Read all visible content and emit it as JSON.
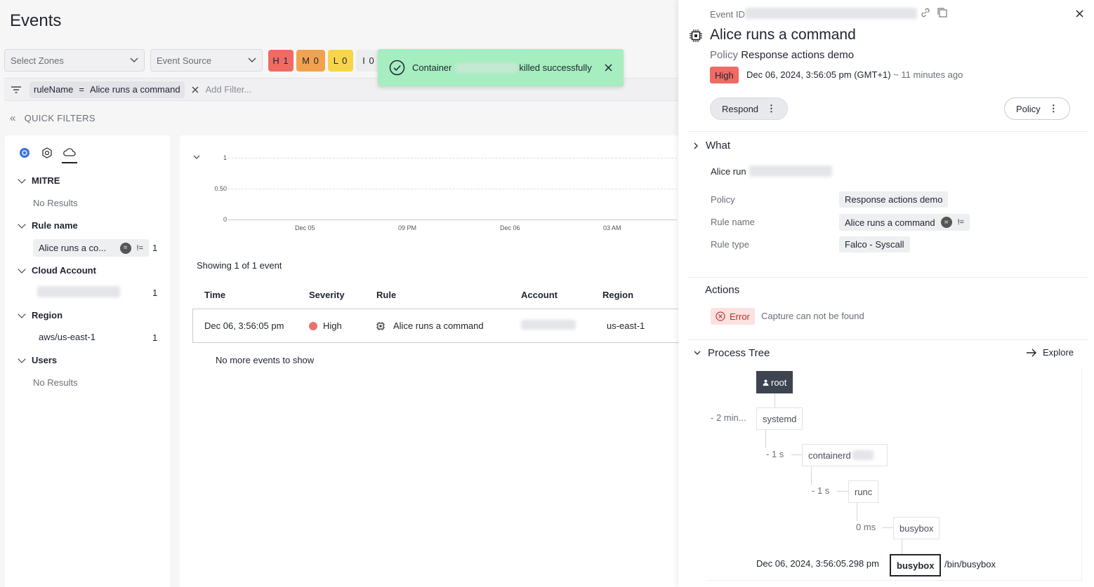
{
  "page": {
    "title": "Events"
  },
  "toolbar": {
    "zones_placeholder": "Select Zones",
    "source_placeholder": "Event Source",
    "severity_chips": [
      {
        "label": "H 1",
        "color": "#ef6b64"
      },
      {
        "label": "M 0",
        "color": "#f2a24f"
      },
      {
        "label": "L 0",
        "color": "#f7d54a"
      },
      {
        "label": "I 0",
        "color": "#eceded"
      }
    ]
  },
  "filter": {
    "key": "ruleName",
    "op": "=",
    "value": "Alice runs a command",
    "add_placeholder": "Add Filter..."
  },
  "quick_filters": {
    "title": "QUICK FILTERS",
    "sections": {
      "mitre": {
        "title": "MITRE",
        "empty": "No Results"
      },
      "rule_name": {
        "title": "Rule name",
        "item": "Alice runs a co...",
        "eq": "=",
        "neq": "!=",
        "count": "1"
      },
      "cloud_account": {
        "title": "Cloud Account",
        "count": "1"
      },
      "region": {
        "title": "Region",
        "item": "aws/us-east-1",
        "count": "1"
      },
      "users": {
        "title": "Users",
        "empty": "No Results"
      }
    }
  },
  "chart_data": {
    "type": "bar",
    "y_ticks": [
      "1",
      "0.50",
      "0"
    ],
    "x_ticks": [
      "Dec 05",
      "09 PM",
      "Dec 06",
      "03 AM"
    ],
    "ylim": [
      0,
      1
    ]
  },
  "events": {
    "showing": "Showing 1 of 1 event",
    "columns": [
      "Time",
      "Severity",
      "Rule",
      "Account",
      "Region"
    ],
    "rows": [
      {
        "time": "Dec 06, 3:56:05 pm",
        "severity": "High",
        "rule": "Alice runs a command",
        "region": "us-east-1"
      }
    ],
    "footer": "No more events to show"
  },
  "toast": {
    "prefix": "Container",
    "suffix": "killed successfully",
    "color": "#a6edc0"
  },
  "drawer": {
    "event_id_label": "Event ID",
    "title": "Alice runs a command",
    "policy_prefix": "Policy",
    "policy_name": "Response actions demo",
    "severity": "High",
    "timestamp": "Dec 06, 2024, 3:56:05 pm (GMT+1)",
    "ago": "~ 11 minutes ago",
    "respond_label": "Respond",
    "policy_button": "Policy",
    "what": {
      "title": "What",
      "summary": "Alice run",
      "fields": [
        {
          "label": "Policy",
          "value": "Response actions demo"
        },
        {
          "label": "Rule name",
          "value": "Alice runs a command"
        },
        {
          "label": "Rule type",
          "value": "Falco - Syscall"
        }
      ],
      "eq": "=",
      "neq": "!="
    },
    "actions": {
      "title": "Actions",
      "status": "Error",
      "message": "Capture can not be found"
    },
    "process_tree": {
      "title": "Process Tree",
      "explore": "Explore",
      "root": "root",
      "nodes": [
        "systemd",
        "containerd",
        "runc",
        "busybox",
        "busybox"
      ],
      "deltas": [
        "- 2 min...",
        "- 1 s",
        "- 1 s",
        "0 ms"
      ],
      "leaf_time": "Dec 06, 2024, 3:56:05.298 pm",
      "leaf_path": "/bin/busybox"
    }
  }
}
